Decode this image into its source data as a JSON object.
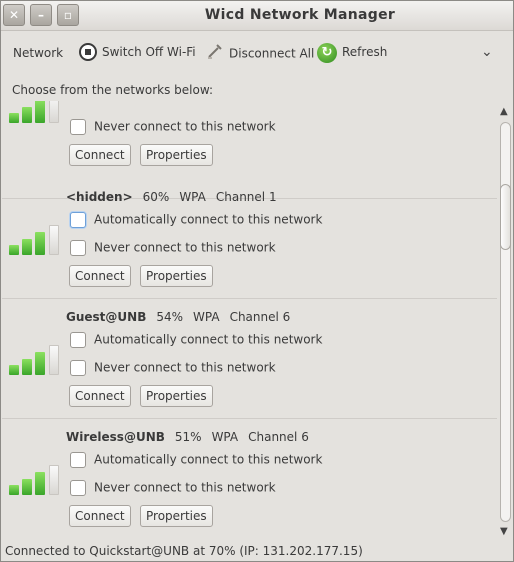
{
  "window": {
    "title": "Wicd Network Manager",
    "controls": [
      "close",
      "minimize",
      "maximize"
    ]
  },
  "toolbar": {
    "network_label": "Network",
    "switch_wifi_label": "Switch Off Wi-Fi",
    "disconnect_label": "Disconnect All",
    "refresh_label": "Refresh"
  },
  "choose_text": "Choose from the networks below:",
  "networks": [
    {
      "ssid": "",
      "strength": "",
      "encryption": "",
      "channel": "",
      "never_label": "Never connect to this network",
      "connect_label": "Connect",
      "properties_label": "Properties"
    },
    {
      "ssid": "<hidden>",
      "strength": "60%",
      "encryption": "WPA",
      "channel": "Channel 1",
      "auto_label": "Automatically connect to this network",
      "never_label": "Never connect to this network",
      "connect_label": "Connect",
      "properties_label": "Properties"
    },
    {
      "ssid": "Guest@UNB",
      "strength": "54%",
      "encryption": "WPA",
      "channel": "Channel 6",
      "auto_label": "Automatically connect to this network",
      "never_label": "Never connect to this network",
      "connect_label": "Connect",
      "properties_label": "Properties"
    },
    {
      "ssid": "Wireless@UNB",
      "strength": "51%",
      "encryption": "WPA",
      "channel": "Channel 6",
      "auto_label": "Automatically connect to this network",
      "never_label": "Never connect to this network",
      "connect_label": "Connect",
      "properties_label": "Properties"
    }
  ],
  "status_text": "Connected to Quickstart@UNB at 70% (IP: 131.202.177.15)",
  "colors": {
    "signal_green": "#3aa52a",
    "refresh_green": "#2e8b1f"
  }
}
